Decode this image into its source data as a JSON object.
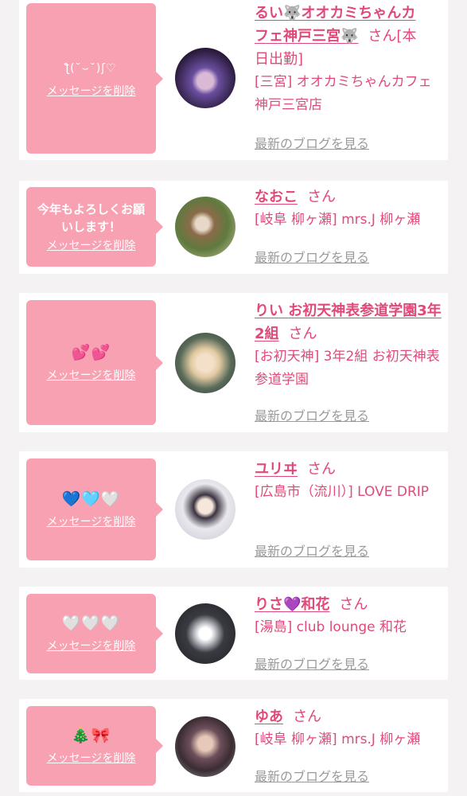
{
  "delete_label": "メッセージを削除",
  "blog_label": "最新のブログを見る",
  "honorific": "さん",
  "entries": [
    {
      "message": "ƪ(˘⌣˘)ʃ♡",
      "name_line1": "るい🐺オオカミちゃんカ",
      "name_line2": "フェ神戸三宮🐺",
      "name_suffix": "[本",
      "name_line3": "日出勤]",
      "shop": "[三宮] オオカミちゃんカフェ神戸三宮店",
      "avatar_colors": [
        "#2a1a3a",
        "#6a4fa0"
      ]
    },
    {
      "message": "今年もよろしくお願いします！",
      "name": "なおこ",
      "shop": "[岐阜 柳ヶ瀬] mrs.J 柳ヶ瀬",
      "avatar_colors": [
        "#6f8a4a",
        "#c9c2a0"
      ]
    },
    {
      "message": "💕💕",
      "name": "りい お初天神表参道学園3年2組",
      "shop": "[お初天神] 3年2組 お初天神表参道学園",
      "avatar_colors": [
        "#f1e3d0",
        "#b3a08a"
      ]
    },
    {
      "message": "💙🩵🤍",
      "name": "ユリヰ",
      "shop": "[広島市（流川）] LOVE DRIP",
      "avatar_colors": [
        "#f3f3f6",
        "#c9c7d4"
      ]
    },
    {
      "message": "🤍🤍🤍",
      "name": "りさ💜和花",
      "shop": "[湯島] club lounge 和花",
      "avatar_colors": [
        "#1f1f24",
        "#7b7b84"
      ]
    },
    {
      "message": "🎄🎀",
      "name": "ゆあ",
      "shop": "[岐阜 柳ヶ瀬] mrs.J 柳ヶ瀬",
      "avatar_colors": [
        "#3b2c33",
        "#8c6d74"
      ]
    }
  ]
}
